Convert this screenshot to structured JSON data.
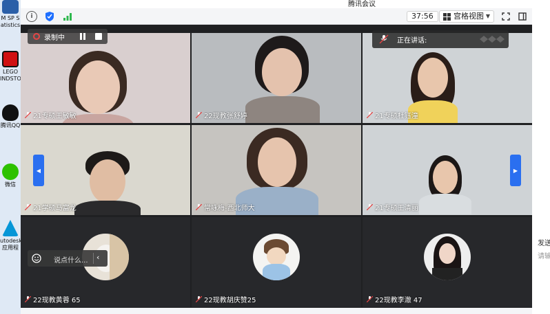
{
  "desktop": {
    "icons": [
      {
        "name": "spss-icon",
        "label": "M SP S",
        "label2": "atistics"
      },
      {
        "name": "lego-icon",
        "label": "LEGO",
        "label2": "INDSTO"
      },
      {
        "name": "qq-icon",
        "label": "腾讯QQ"
      },
      {
        "name": "wechat-icon",
        "label": "微信"
      },
      {
        "name": "autodesk-icon",
        "label": "utodesk",
        "label2": "应用程"
      }
    ]
  },
  "window": {
    "title": "腾讯会议",
    "timer": "37:56",
    "layout_label": "宫格视图"
  },
  "recording": {
    "label": "录制中"
  },
  "speaking": {
    "label": "正在讲话:"
  },
  "chat": {
    "placeholder": "说点什么..."
  },
  "participants": [
    {
      "name": "21专硕王敏敏"
    },
    {
      "name": "22现教张舒婷"
    },
    {
      "name": "21专硕杜钰潼"
    },
    {
      "name": "21学硕马富龙"
    },
    {
      "name": "常咏梅-西北师大"
    },
    {
      "name": "21专硕王清丽"
    },
    {
      "name": "22现教黄蓉 65"
    },
    {
      "name": "22现教胡庆赞25"
    },
    {
      "name": "22现教李澈 47"
    }
  ],
  "right_panel": {
    "text1": "发送",
    "text2": "请输"
  },
  "colors": {
    "accent": "#2a6ff0",
    "record": "#e54545",
    "background": "#1f2022"
  }
}
